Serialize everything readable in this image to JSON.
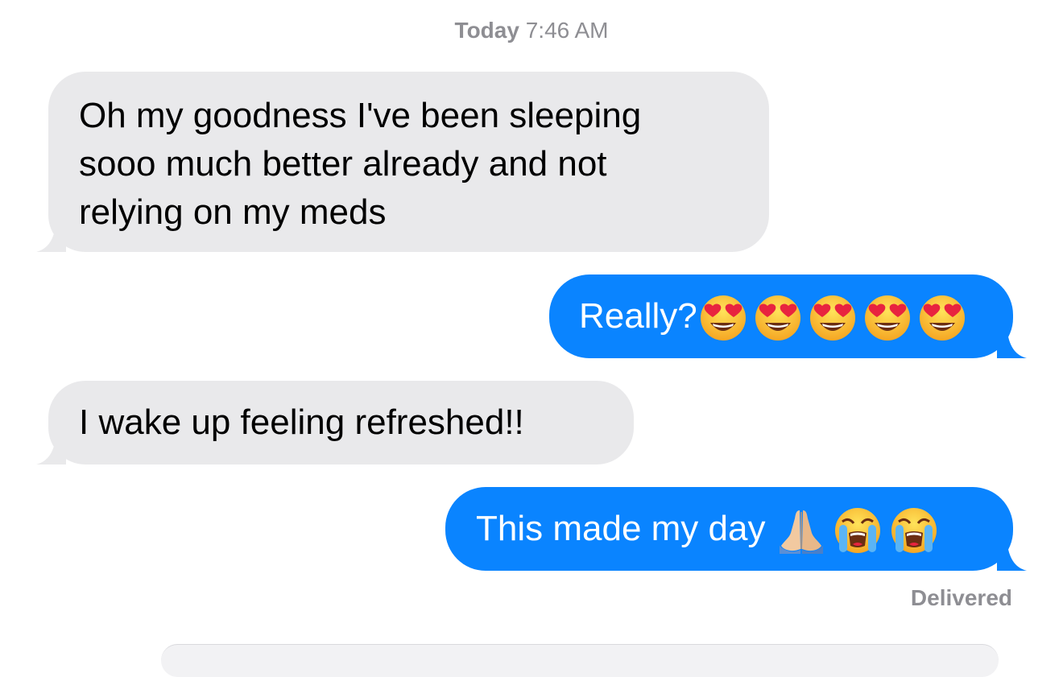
{
  "header": {
    "timestamp_day": "Today",
    "timestamp_time": "7:46 AM"
  },
  "colors": {
    "incoming_bubble": "#e9e9eb",
    "outgoing_bubble": "#0a84ff",
    "meta_text": "#8e8e93"
  },
  "messages": [
    {
      "direction": "incoming",
      "lines": [
        "Oh my goodness I've been sleeping",
        "sooo much better already and not",
        "relying on my meds"
      ]
    },
    {
      "direction": "outgoing",
      "text": "Really?",
      "emojis": [
        "heart-eyes-emoji",
        "heart-eyes-emoji",
        "heart-eyes-emoji",
        "heart-eyes-emoji",
        "heart-eyes-emoji"
      ]
    },
    {
      "direction": "incoming",
      "text": "I wake up feeling refreshed!!"
    },
    {
      "direction": "outgoing",
      "text": "This made my day",
      "emojis": [
        "folded-hands-emoji",
        "loudly-crying-emoji",
        "loudly-crying-emoji"
      ]
    }
  ],
  "status": {
    "delivered": "Delivered"
  }
}
